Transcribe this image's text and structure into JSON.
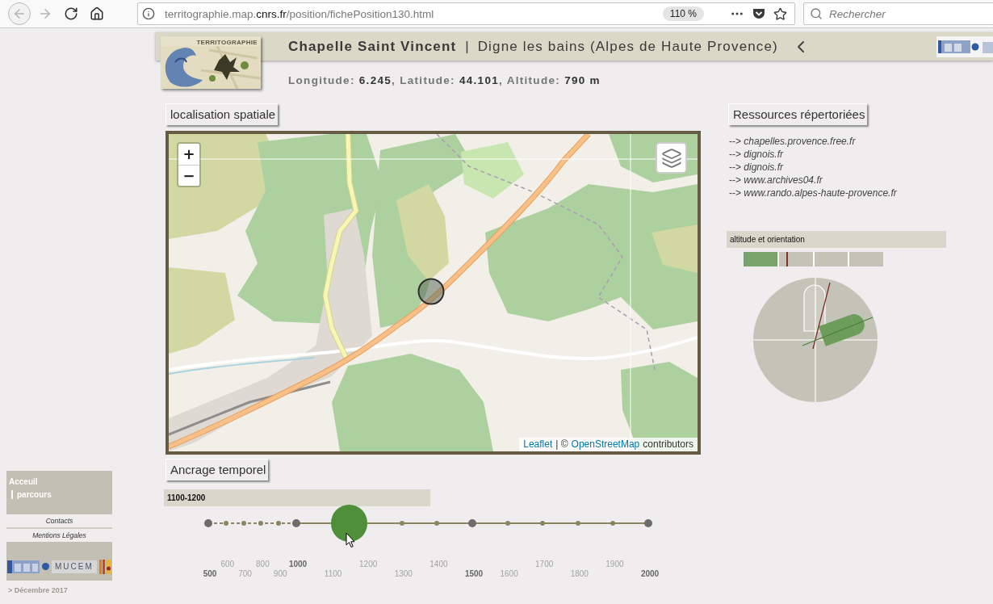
{
  "browser": {
    "nav_buttons": [
      {
        "kind": "back",
        "disabled": true
      },
      {
        "kind": "forward",
        "disabled": true
      },
      {
        "kind": "reload",
        "disabled": false
      },
      {
        "kind": "home",
        "disabled": false
      }
    ],
    "url": {
      "host_start": "territographie.map.",
      "host_domain": "cnrs.fr",
      "path": "/position/fichePosition130.html"
    },
    "zoom": "110 %",
    "search": {
      "placeholder": "Rechercher"
    }
  },
  "header": {
    "logo_text": "TERRITOGRAPHIE",
    "title": "Chapelle Saint Vincent",
    "separator": "|",
    "place": "Digne les bains (Alpes de Haute Provence)",
    "coordinates": "Longitude: **6.245**, Latitude: **44.101**, Altitude: **790 m**"
  },
  "map_section": {
    "heading": "localisation spatiale",
    "zoom_in": "+",
    "zoom_out": "−",
    "attribution": [
      {
        "kind": "link",
        "text": "Leaflet"
      },
      {
        "kind": "text",
        "text": "| ©"
      },
      {
        "kind": "link",
        "text": "OpenStreetMap"
      },
      {
        "kind": "text",
        "text": "contributors"
      }
    ]
  },
  "timeline": {
    "heading": "Ancrage temporel",
    "period": "1100-1200",
    "runs": [
      {
        "dashed": true,
        "ticks": [
          {
            "label": "500",
            "major": true,
            "selected": false
          },
          {
            "label": "600",
            "major": false,
            "selected": false
          },
          {
            "label": "700",
            "major": false,
            "selected": false
          },
          {
            "label": "800",
            "major": false,
            "selected": false
          },
          {
            "label": "900",
            "major": false,
            "selected": false
          }
        ]
      },
      {
        "dashed": false,
        "ticks": [
          {
            "label": "1000",
            "major": true,
            "selected": false
          },
          {
            "label": "1100",
            "major": false,
            "selected": true
          },
          {
            "label": "1200",
            "major": false,
            "selected": true
          },
          {
            "label": "1300",
            "major": false,
            "selected": false
          },
          {
            "label": "1400",
            "major": false,
            "selected": false
          },
          {
            "label": "1500",
            "major": true,
            "selected": false
          },
          {
            "label": "1600",
            "major": false,
            "selected": false
          },
          {
            "label": "1700",
            "major": false,
            "selected": false
          },
          {
            "label": "1800",
            "major": false,
            "selected": false
          },
          {
            "label": "1900",
            "major": false,
            "selected": false
          },
          {
            "label": "2000",
            "major": true,
            "selected": false
          }
        ]
      }
    ]
  },
  "resources": {
    "heading": "Ressources répertoriées",
    "links": [
      "--> *chapelles.provence.free.fr*",
      "--> *dignois.fr*",
      "--> *dignois.fr*",
      "--> *www.archives04.fr*",
      "--> *www.rando.alpes-haute-provence.fr*"
    ]
  },
  "altitude": {
    "heading": "altitude et orientation",
    "segments": [
      {
        "selected": true
      },
      {
        "selected": false
      },
      {
        "selected": false
      },
      {
        "selected": false
      }
    ],
    "level": 0.31
  },
  "sidebar": {
    "nav": [
      {
        "kind": "main",
        "label": "Acceuil"
      },
      {
        "kind": "sub",
        "label": "parcours"
      }
    ],
    "links": [
      "Contacts",
      "Mentions Légales"
    ],
    "logo_text": "MUCEM",
    "date": "> Décembre 2017"
  }
}
